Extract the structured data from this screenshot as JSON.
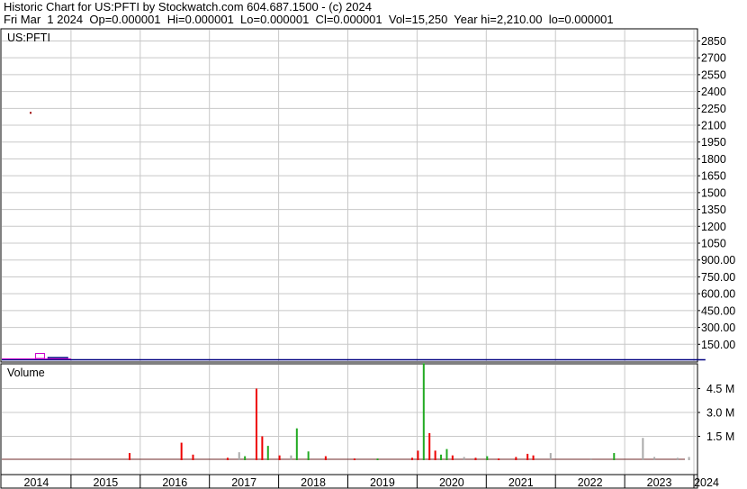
{
  "header": {
    "title": "Historic Chart for US:PFTI by Stockwatch.com 604.687.1500 - (c) 2024",
    "stats": "Fri Mar  1 2024  Op=0.000001  Hi=0.000001  Lo=0.000001  Cl=0.000001  Vol=15,250  Year hi=2,210.00  lo=0.000001"
  },
  "colors": {
    "grid": "#c8c8c8",
    "price_line": "#000080",
    "price_box": "#cc00cc",
    "dot": "#990000",
    "vol_up": "#22aa22",
    "vol_down": "#ee0000",
    "vol_neutral": "#aaaaaa"
  },
  "chart_data": [
    {
      "type": "line",
      "title": "US:PFTI",
      "ylim": [
        0,
        2950
      ],
      "y_ticks": [
        "2850",
        "2700",
        "2550",
        "2400",
        "2250",
        "2100",
        "1950",
        "1800",
        "1650",
        "1500",
        "1350",
        "1200",
        "1050",
        "900.00",
        "750.00",
        "600.00",
        "450.00",
        "300.00",
        "150.00"
      ],
      "y_tick_values": [
        2850,
        2700,
        2550,
        2400,
        2250,
        2100,
        1950,
        1800,
        1650,
        1500,
        1350,
        1200,
        1050,
        900,
        750,
        600,
        450,
        300,
        150
      ],
      "x_tick_labels": [
        "2014",
        "2015",
        "2016",
        "2017",
        "2018",
        "2019",
        "2020",
        "2021",
        "2022",
        "2023",
        "2024"
      ],
      "series": [
        {
          "values": [
            {
              "x": "2014-06",
              "y": 2210
            },
            {
              "x": "2014-07",
              "y": 60
            },
            {
              "x": "2014-09",
              "y": 25
            },
            {
              "x": "2015-01",
              "y": 5
            },
            {
              "x": "2024-03",
              "y": 1e-06
            }
          ]
        }
      ]
    },
    {
      "type": "bar",
      "title": "Volume",
      "ylim": [
        0,
        6000000
      ],
      "y_ticks": [
        "4.5 M",
        "3.0 M",
        "1.5 M"
      ],
      "y_tick_values": [
        4500000,
        3000000,
        1500000
      ],
      "series": [
        {
          "name": "Volume",
          "values": [
            {
              "x": "2015-11",
              "y": 450000,
              "dir": "down"
            },
            {
              "x": "2016-08",
              "y": 1100000,
              "dir": "down"
            },
            {
              "x": "2016-10",
              "y": 350000,
              "dir": "down"
            },
            {
              "x": "2017-04",
              "y": 150000,
              "dir": "down"
            },
            {
              "x": "2017-06",
              "y": 500000,
              "dir": "neutral"
            },
            {
              "x": "2017-07",
              "y": 250000,
              "dir": "up"
            },
            {
              "x": "2017-09",
              "y": 4500000,
              "dir": "down"
            },
            {
              "x": "2017-10",
              "y": 1500000,
              "dir": "down"
            },
            {
              "x": "2017-11",
              "y": 900000,
              "dir": "up"
            },
            {
              "x": "2018-01",
              "y": 300000,
              "dir": "down"
            },
            {
              "x": "2018-03",
              "y": 300000,
              "dir": "neutral"
            },
            {
              "x": "2018-04",
              "y": 2000000,
              "dir": "up"
            },
            {
              "x": "2018-06",
              "y": 550000,
              "dir": "up"
            },
            {
              "x": "2018-09",
              "y": 250000,
              "dir": "down"
            },
            {
              "x": "2019-02",
              "y": 100000,
              "dir": "down"
            },
            {
              "x": "2019-06",
              "y": 100000,
              "dir": "up"
            },
            {
              "x": "2019-12",
              "y": 150000,
              "dir": "down"
            },
            {
              "x": "2020-01",
              "y": 600000,
              "dir": "down"
            },
            {
              "x": "2020-02",
              "y": 6100000,
              "dir": "up"
            },
            {
              "x": "2020-03",
              "y": 1700000,
              "dir": "down"
            },
            {
              "x": "2020-04",
              "y": 600000,
              "dir": "down"
            },
            {
              "x": "2020-05",
              "y": 350000,
              "dir": "up"
            },
            {
              "x": "2020-06",
              "y": 700000,
              "dir": "up"
            },
            {
              "x": "2020-07",
              "y": 300000,
              "dir": "down"
            },
            {
              "x": "2020-09",
              "y": 200000,
              "dir": "neutral"
            },
            {
              "x": "2020-11",
              "y": 150000,
              "dir": "down"
            },
            {
              "x": "2021-01",
              "y": 250000,
              "dir": "up"
            },
            {
              "x": "2021-03",
              "y": 100000,
              "dir": "down"
            },
            {
              "x": "2021-06",
              "y": 200000,
              "dir": "down"
            },
            {
              "x": "2021-08",
              "y": 400000,
              "dir": "down"
            },
            {
              "x": "2021-09",
              "y": 300000,
              "dir": "down"
            },
            {
              "x": "2021-12",
              "y": 450000,
              "dir": "neutral"
            },
            {
              "x": "2022-07",
              "y": 100000,
              "dir": "neutral"
            },
            {
              "x": "2022-11",
              "y": 450000,
              "dir": "up"
            },
            {
              "x": "2023-04",
              "y": 1400000,
              "dir": "neutral"
            },
            {
              "x": "2023-06",
              "y": 200000,
              "dir": "neutral"
            },
            {
              "x": "2023-10",
              "y": 150000,
              "dir": "neutral"
            },
            {
              "x": "2023-12",
              "y": 200000,
              "dir": "neutral"
            }
          ]
        }
      ]
    }
  ]
}
